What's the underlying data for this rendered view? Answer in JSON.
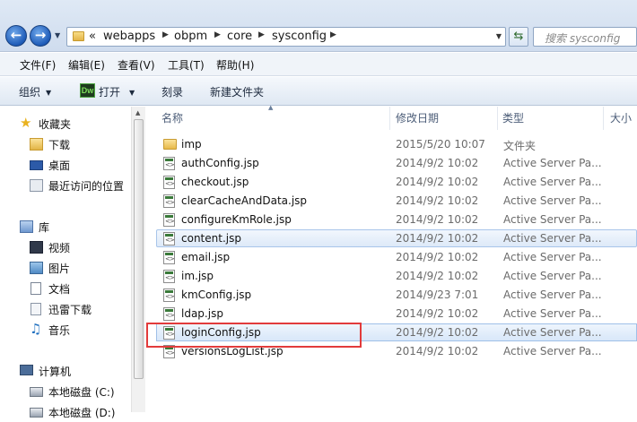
{
  "address": {
    "chevrons": "«",
    "crumbs": [
      "webapps",
      "obpm",
      "core",
      "sysconfig"
    ],
    "search_placeholder": "搜索 sysconfig"
  },
  "menu": [
    "文件(F)",
    "编辑(E)",
    "查看(V)",
    "工具(T)",
    "帮助(H)"
  ],
  "commands": {
    "organize": "组织",
    "dw_badge": "Dw",
    "open": "打开",
    "burn": "刻录",
    "new_folder": "新建文件夹"
  },
  "nav": {
    "favorites": "收藏夹",
    "downloads": "下载",
    "desktop": "桌面",
    "recent": "最近访问的位置",
    "libraries": "库",
    "videos": "视频",
    "pictures": "图片",
    "documents": "文档",
    "thunder": "迅雷下载",
    "music": "音乐",
    "computer": "计算机",
    "local_c": "本地磁盘 (C:)",
    "local_d": "本地磁盘 (D:)"
  },
  "columns": {
    "name": "名称",
    "modified": "修改日期",
    "type": "类型",
    "size": "大小"
  },
  "files": [
    {
      "name": "imp",
      "date": "2015/5/20 10:07",
      "type": "文件夹",
      "kind": "folder"
    },
    {
      "name": "authConfig.jsp",
      "date": "2014/9/2 10:02",
      "type": "Active Server Pa...",
      "kind": "jsp"
    },
    {
      "name": "checkout.jsp",
      "date": "2014/9/2 10:02",
      "type": "Active Server Pa...",
      "kind": "jsp"
    },
    {
      "name": "clearCacheAndData.jsp",
      "date": "2014/9/2 10:02",
      "type": "Active Server Pa...",
      "kind": "jsp"
    },
    {
      "name": "configureKmRole.jsp",
      "date": "2014/9/2 10:02",
      "type": "Active Server Pa...",
      "kind": "jsp"
    },
    {
      "name": "content.jsp",
      "date": "2014/9/2 10:02",
      "type": "Active Server Pa...",
      "kind": "jsp"
    },
    {
      "name": "email.jsp",
      "date": "2014/9/2 10:02",
      "type": "Active Server Pa...",
      "kind": "jsp"
    },
    {
      "name": "im.jsp",
      "date": "2014/9/2 10:02",
      "type": "Active Server Pa...",
      "kind": "jsp"
    },
    {
      "name": "kmConfig.jsp",
      "date": "2014/9/23 7:01",
      "type": "Active Server Pa...",
      "kind": "jsp"
    },
    {
      "name": "ldap.jsp",
      "date": "2014/9/2 10:02",
      "type": "Active Server Pa...",
      "kind": "jsp"
    },
    {
      "name": "loginConfig.jsp",
      "date": "2014/9/2 10:02",
      "type": "Active Server Pa...",
      "kind": "jsp"
    },
    {
      "name": "versionsLogList.jsp",
      "date": "2014/9/2 10:02",
      "type": "Active Server Pa...",
      "kind": "jsp"
    }
  ],
  "colors": {
    "highlight": "#e23b3b",
    "selection": "#dde9f8"
  }
}
